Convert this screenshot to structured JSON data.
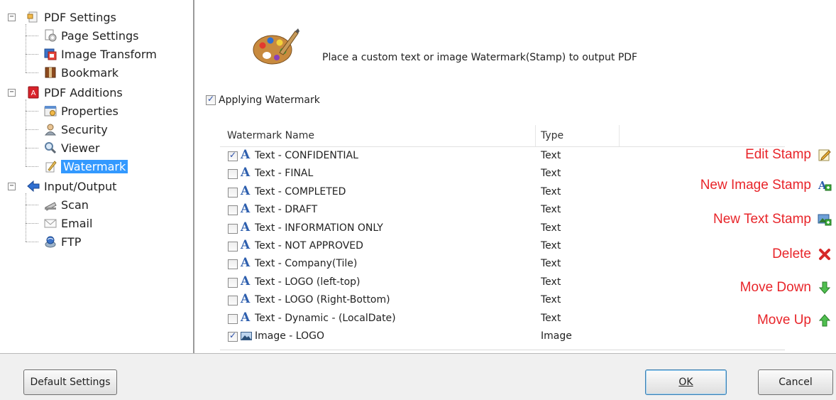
{
  "tree": {
    "items": [
      {
        "label": "PDF Settings",
        "icon": "pdf-settings-icon"
      },
      {
        "label": "Page Settings",
        "icon": "page-settings-icon"
      },
      {
        "label": "Image Transform",
        "icon": "image-transform-icon"
      },
      {
        "label": "Bookmark",
        "icon": "bookmark-icon"
      },
      {
        "label": "PDF Additions",
        "icon": "pdf-additions-icon"
      },
      {
        "label": "Properties",
        "icon": "properties-icon"
      },
      {
        "label": "Security",
        "icon": "security-icon"
      },
      {
        "label": "Viewer",
        "icon": "viewer-icon"
      },
      {
        "label": "Watermark",
        "icon": "watermark-icon",
        "selected": true
      },
      {
        "label": "Input/Output",
        "icon": "input-output-icon"
      },
      {
        "label": "Scan",
        "icon": "scan-icon"
      },
      {
        "label": "Email",
        "icon": "email-icon"
      },
      {
        "label": "FTP",
        "icon": "ftp-icon"
      }
    ],
    "selection_color": "#3399ff"
  },
  "header": {
    "icon": "palette-icon",
    "description": "Place a custom text or image Watermark(Stamp) to output PDF"
  },
  "apply": {
    "label": "Applying Watermark",
    "checked": true
  },
  "table": {
    "columns": [
      "Watermark Name",
      "Type"
    ],
    "rows": [
      {
        "checked": true,
        "icon": "text-icon",
        "name": "Text - CONFIDENTIAL",
        "type": "Text"
      },
      {
        "checked": false,
        "icon": "text-icon",
        "name": "Text - FINAL",
        "type": "Text"
      },
      {
        "checked": false,
        "icon": "text-icon",
        "name": "Text - COMPLETED",
        "type": "Text"
      },
      {
        "checked": false,
        "icon": "text-icon",
        "name": "Text - DRAFT",
        "type": "Text"
      },
      {
        "checked": false,
        "icon": "text-icon",
        "name": "Text - INFORMATION ONLY",
        "type": "Text"
      },
      {
        "checked": false,
        "icon": "text-icon",
        "name": "Text - NOT APPROVED",
        "type": "Text"
      },
      {
        "checked": false,
        "icon": "text-icon",
        "name": "Text - Company(Tile)",
        "type": "Text"
      },
      {
        "checked": false,
        "icon": "text-icon",
        "name": "Text - LOGO (left-top)",
        "type": "Text"
      },
      {
        "checked": false,
        "icon": "text-icon",
        "name": "Text - LOGO (Right-Bottom)",
        "type": "Text"
      },
      {
        "checked": false,
        "icon": "text-icon",
        "name": "Text - Dynamic - (LocalDate)",
        "type": "Text"
      },
      {
        "checked": true,
        "icon": "image-icon",
        "name": "Image - LOGO",
        "type": "Image"
      }
    ]
  },
  "actions": {
    "edit_stamp": {
      "label": "Edit Stamp",
      "icon": "edit-stamp-icon"
    },
    "new_image_stamp": {
      "label": "New Image Stamp",
      "icon": "new-image-stamp-icon"
    },
    "new_text_stamp": {
      "label": "New Text Stamp",
      "icon": "new-text-stamp-icon"
    },
    "delete": {
      "label": "Delete",
      "icon": "delete-icon"
    },
    "move_down": {
      "label": "Move Down",
      "icon": "move-down-icon"
    },
    "move_up": {
      "label": "Move Up",
      "icon": "move-up-icon"
    },
    "color": "#e8252a"
  },
  "footer": {
    "default_settings": "Default Settings",
    "ok": "OK",
    "cancel": "Cancel"
  }
}
